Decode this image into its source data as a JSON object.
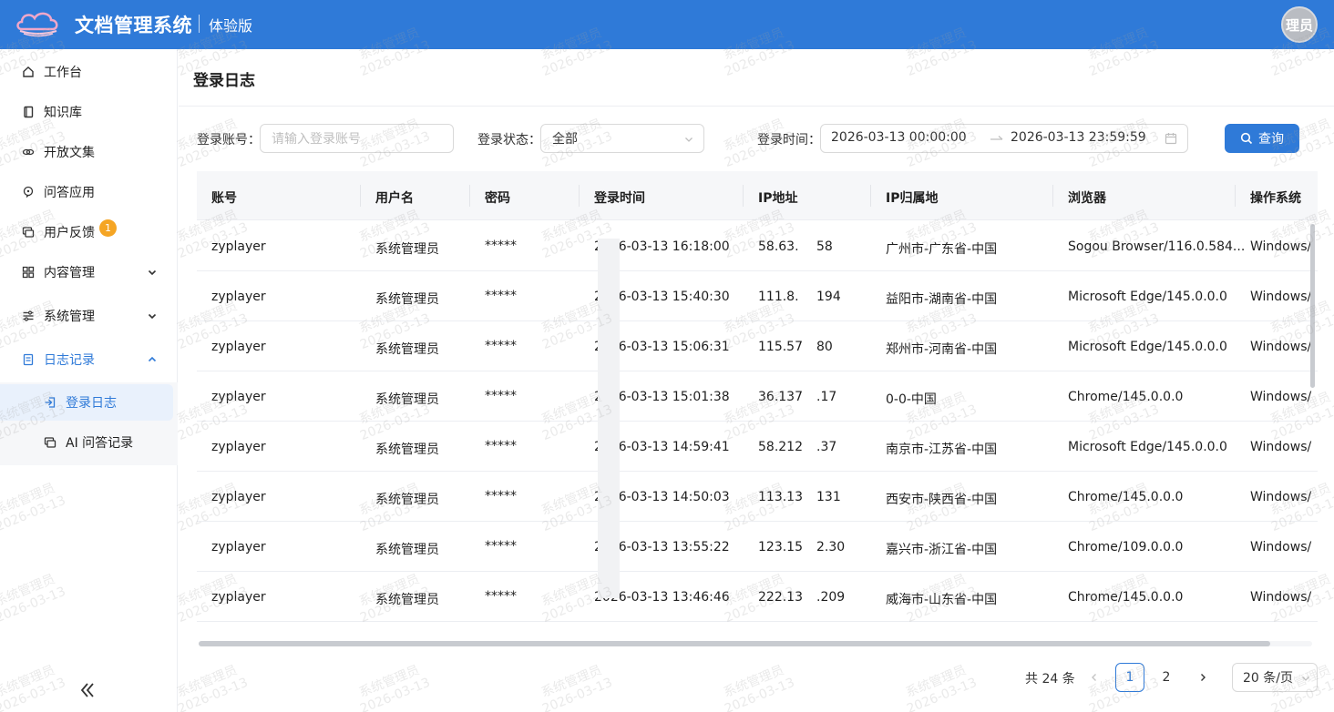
{
  "header": {
    "app_title": "文档管理系统",
    "edition": "体验版",
    "avatar_text": "理员",
    "brand_color": "#2f7ad8"
  },
  "sidebar": {
    "items": [
      {
        "label": "工作台",
        "icon": "home-icon"
      },
      {
        "label": "知识库",
        "icon": "book-icon"
      },
      {
        "label": "开放文集",
        "icon": "link-icon"
      },
      {
        "label": "问答应用",
        "icon": "qa-icon"
      },
      {
        "label": "用户反馈",
        "icon": "feedback-icon",
        "badge": "1"
      },
      {
        "label": "内容管理",
        "icon": "grid-icon",
        "expandable": true
      },
      {
        "label": "系统管理",
        "icon": "sliders-icon",
        "expandable": true
      },
      {
        "label": "日志记录",
        "icon": "log-icon",
        "expanded": true
      }
    ],
    "sub_items": [
      {
        "label": "登录日志",
        "icon": "login-icon",
        "active": true
      },
      {
        "label": "AI 问答记录",
        "icon": "chat-icon"
      }
    ],
    "collapse_icon": "double-chevron-left-icon"
  },
  "page": {
    "title": "登录日志"
  },
  "filters": {
    "account_label": "登录账号：",
    "account_placeholder": "请输入登录账号",
    "status_label": "登录状态：",
    "status_value": "全部",
    "time_label": "登录时间：",
    "time_start": "2026-03-13 00:00:00",
    "time_end": "2026-03-13 23:59:59",
    "query_label": "查询"
  },
  "table": {
    "columns": [
      "账号",
      "用户名",
      "密码",
      "登录时间",
      "IP地址",
      "IP归属地",
      "浏览器",
      "操作系统"
    ],
    "rows": [
      {
        "account": "zyplayer",
        "username": "系统管理员",
        "password": "*****",
        "time": "2026-03-13 16:18:00",
        "ip": "58.63.",
        "ip_tail": "58",
        "location": "广州市-广东省-中国",
        "browser": "Sogou Browser/116.0.584...",
        "os": "Windows/"
      },
      {
        "account": "zyplayer",
        "username": "系统管理员",
        "password": "*****",
        "time": "2026-03-13 15:40:30",
        "ip": "111.8.",
        "ip_tail": "194",
        "location": "益阳市-湖南省-中国",
        "browser": "Microsoft Edge/145.0.0.0",
        "os": "Windows/"
      },
      {
        "account": "zyplayer",
        "username": "系统管理员",
        "password": "*****",
        "time": "2026-03-13 15:06:31",
        "ip": "115.57",
        "ip_tail": "80",
        "location": "郑州市-河南省-中国",
        "browser": "Microsoft Edge/145.0.0.0",
        "os": "Windows/"
      },
      {
        "account": "zyplayer",
        "username": "系统管理员",
        "password": "*****",
        "time": "2026-03-13 15:01:38",
        "ip": "36.137",
        "ip_tail": ".17",
        "location": "0-0-中国",
        "browser": "Chrome/145.0.0.0",
        "os": "Windows/"
      },
      {
        "account": "zyplayer",
        "username": "系统管理员",
        "password": "*****",
        "time": "2026-03-13 14:59:41",
        "ip": "58.212",
        "ip_tail": ".37",
        "location": "南京市-江苏省-中国",
        "browser": "Microsoft Edge/145.0.0.0",
        "os": "Windows/"
      },
      {
        "account": "zyplayer",
        "username": "系统管理员",
        "password": "*****",
        "time": "2026-03-13 14:50:03",
        "ip": "113.13",
        "ip_tail": "131",
        "location": "西安市-陕西省-中国",
        "browser": "Chrome/145.0.0.0",
        "os": "Windows/"
      },
      {
        "account": "zyplayer",
        "username": "系统管理员",
        "password": "*****",
        "time": "2026-03-13 13:55:22",
        "ip": "123.15",
        "ip_tail": "2.30",
        "location": "嘉兴市-浙江省-中国",
        "browser": "Chrome/109.0.0.0",
        "os": "Windows/"
      },
      {
        "account": "zyplayer",
        "username": "系统管理员",
        "password": "*****",
        "time": "2026-03-13 13:46:46",
        "ip": "222.13",
        "ip_tail": ".209",
        "location": "威海市-山东省-中国",
        "browser": "Chrome/145.0.0.0",
        "os": "Windows/"
      }
    ]
  },
  "pagination": {
    "total_text": "共 24 条",
    "pages": [
      "1",
      "2"
    ],
    "current_page": "1",
    "page_size": "20 条/页"
  },
  "watermark": {
    "line1": "系统管理员",
    "line2": "2026-03-13"
  }
}
